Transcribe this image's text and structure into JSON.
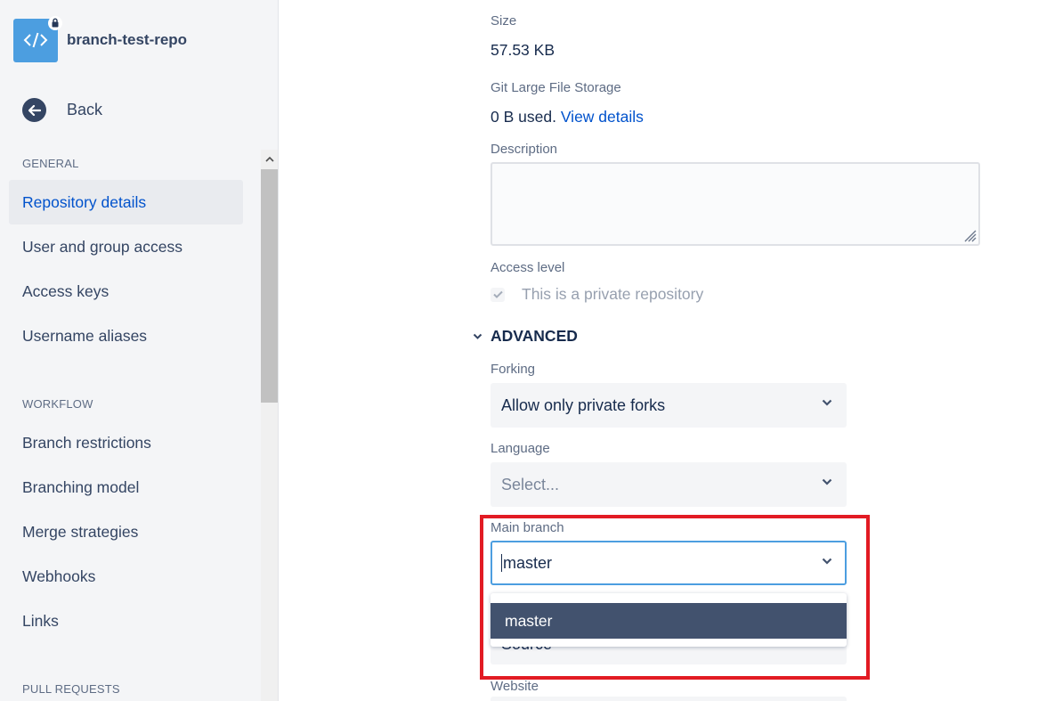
{
  "repo": {
    "name": "branch-test-repo",
    "avatar_icon": "code-icon",
    "private_badge_icon": "lock-icon"
  },
  "sidebar": {
    "back_label": "Back",
    "sections": {
      "general": "GENERAL",
      "workflow": "WORKFLOW",
      "pull_requests": "PULL REQUESTS"
    },
    "general_items": [
      {
        "label": "Repository details",
        "active": true
      },
      {
        "label": "User and group access"
      },
      {
        "label": "Access keys"
      },
      {
        "label": "Username aliases"
      }
    ],
    "workflow_items": [
      {
        "label": "Branch restrictions"
      },
      {
        "label": "Branching model"
      },
      {
        "label": "Merge strategies"
      },
      {
        "label": "Webhooks"
      },
      {
        "label": "Links"
      }
    ]
  },
  "form": {
    "size": {
      "label": "Size",
      "value": "57.53 KB"
    },
    "lfs": {
      "label": "Git Large File Storage",
      "value": "0 B used.",
      "link": "View details"
    },
    "description": {
      "label": "Description",
      "value": ""
    },
    "access": {
      "label": "Access level",
      "checkbox_label": "This is a private repository",
      "checked": true,
      "disabled": true
    },
    "advanced": {
      "label": "ADVANCED",
      "expanded": true
    },
    "forking": {
      "label": "Forking",
      "value": "Allow only private forks"
    },
    "language": {
      "label": "Language",
      "placeholder": "Select..."
    },
    "main_branch": {
      "label": "Main branch",
      "value": "master",
      "options": [
        "master"
      ]
    },
    "obscured_field": {
      "value": "Source"
    },
    "website": {
      "label": "Website"
    }
  },
  "colors": {
    "accent": "#0052cc",
    "sidebar_bg": "#f4f5f7",
    "selected_option_bg": "#42526e",
    "focus_border": "#4c9ee0",
    "highlight": "#e21b23"
  }
}
